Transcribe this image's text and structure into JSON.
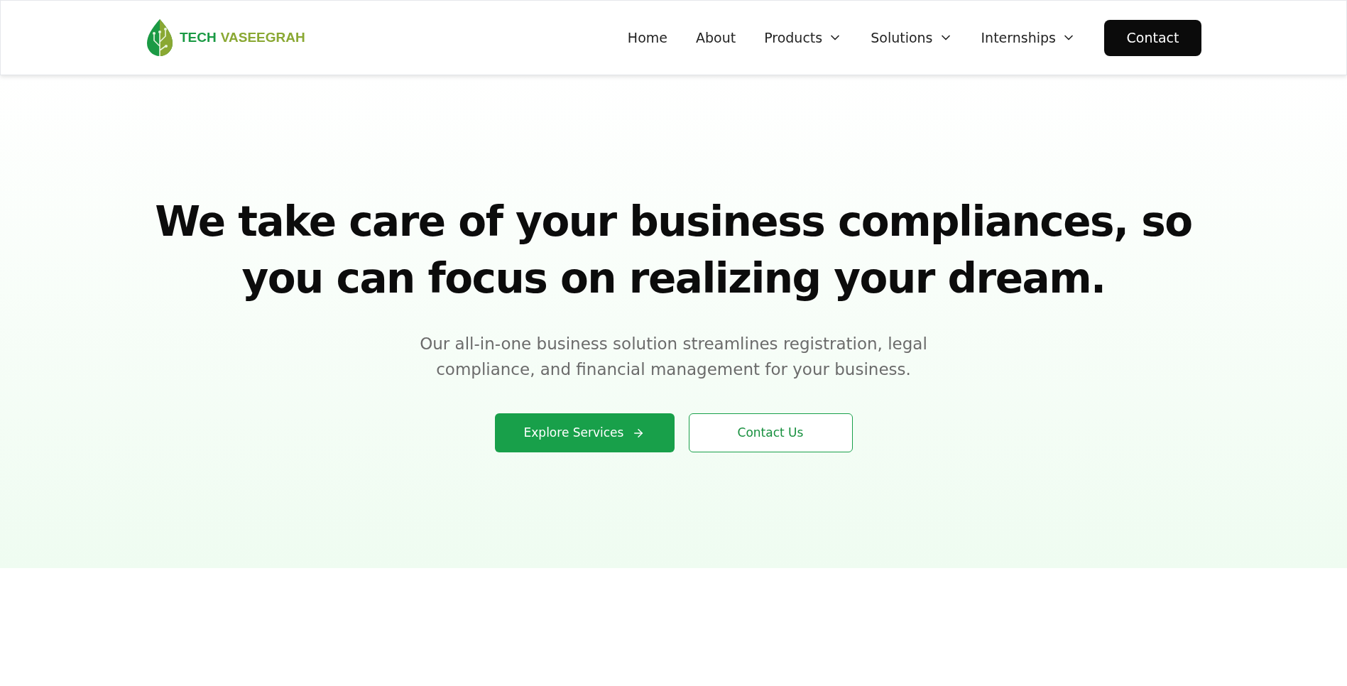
{
  "logo": {
    "words": [
      "TECH",
      "VASEEGRAH"
    ]
  },
  "nav": [
    {
      "label": "Home",
      "dropdown": false
    },
    {
      "label": "About",
      "dropdown": false
    },
    {
      "label": "Products",
      "dropdown": true
    },
    {
      "label": "Solutions",
      "dropdown": true
    },
    {
      "label": "Internships",
      "dropdown": true
    }
  ],
  "contact_button": "Contact",
  "hero": {
    "heading": "We take care of your business compliances, so you can focus on realizing your dream.",
    "subtitle": "Our all-in-one business solution streamlines registration, legal compliance, and financial management for your business.",
    "buttons": [
      {
        "label": "Explore Services",
        "kind": "primary"
      },
      {
        "label": "Contact Us",
        "kind": "outline"
      }
    ]
  }
}
